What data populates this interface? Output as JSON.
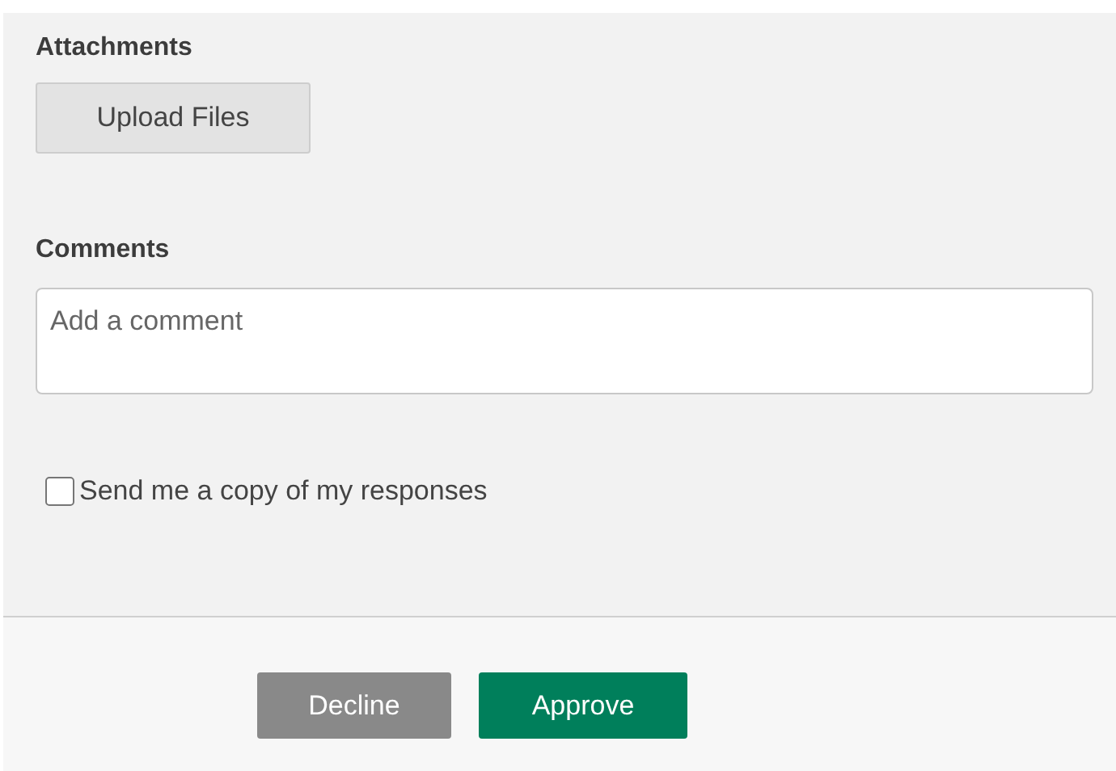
{
  "attachments": {
    "label": "Attachments",
    "button": "Upload Files"
  },
  "comments": {
    "label": "Comments",
    "placeholder": "Add a comment"
  },
  "copy_option": {
    "label": "Send me a copy of my responses",
    "checked": false
  },
  "buttons": [
    {
      "label": "Decline",
      "kind": "decline"
    },
    {
      "label": "Approve",
      "kind": "approve"
    }
  ]
}
